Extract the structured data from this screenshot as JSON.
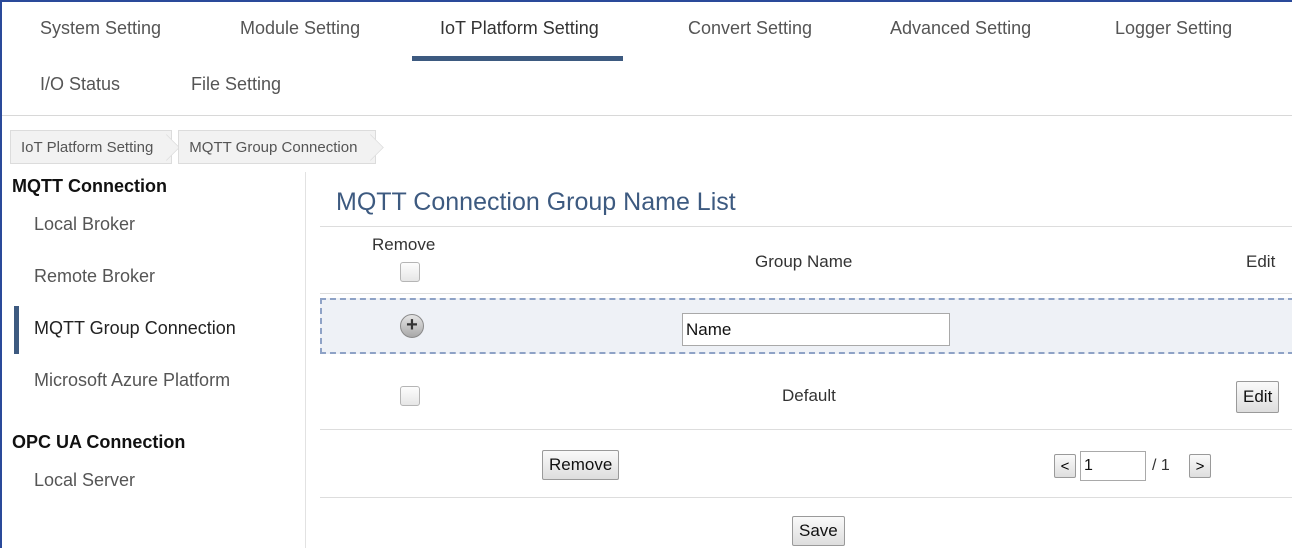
{
  "tabs": {
    "row1": [
      "System Setting",
      "Module Setting",
      "IoT Platform Setting",
      "Convert Setting",
      "Advanced Setting",
      "Logger Setting"
    ],
    "row2": [
      "I/O Status",
      "File Setting"
    ],
    "active": "IoT Platform Setting"
  },
  "breadcrumb": [
    "IoT Platform Setting",
    "MQTT Group Connection"
  ],
  "sidebar": {
    "mqtt_heading": "MQTT Connection",
    "mqtt_items": [
      "Local Broker",
      "Remote Broker",
      "MQTT Group Connection",
      "Microsoft Azure Platform"
    ],
    "opc_heading": "OPC UA Connection",
    "opc_items": [
      "Local Server"
    ],
    "active": "MQTT Group Connection"
  },
  "main": {
    "title": "MQTT Connection Group Name List",
    "columns": {
      "remove": "Remove",
      "group_name": "Group Name",
      "edit": "Edit"
    },
    "add_row": {
      "name_value": "Name"
    },
    "rows": [
      {
        "group_name": "Default",
        "edit_label": "Edit"
      }
    ],
    "remove_button": "Remove",
    "pager": {
      "prev": "<",
      "page": "1",
      "total": "/ 1",
      "next": ">"
    },
    "save_button": "Save"
  },
  "colors": {
    "accent": "#3d5a80",
    "frame": "#2a4a9a",
    "dashed_border": "#8ea2c6"
  }
}
